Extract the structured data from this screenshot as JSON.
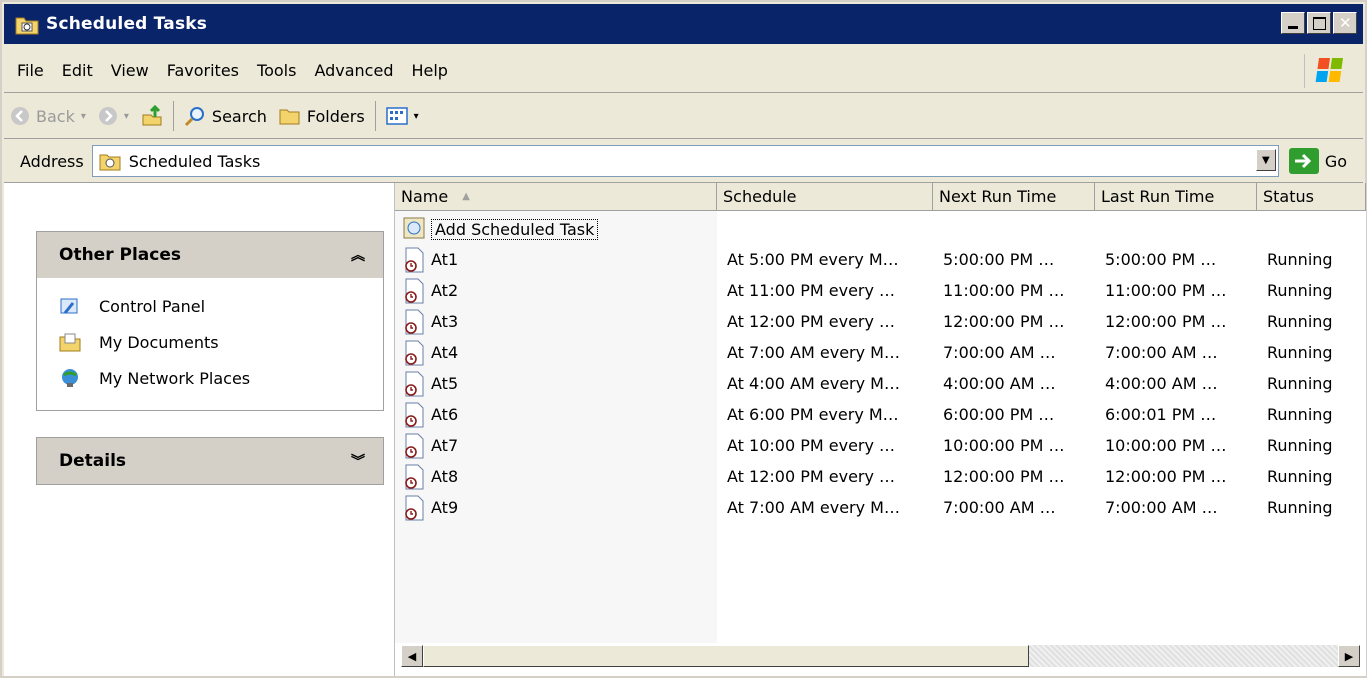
{
  "window": {
    "title": "Scheduled Tasks"
  },
  "menu": [
    "File",
    "Edit",
    "View",
    "Favorites",
    "Tools",
    "Advanced",
    "Help"
  ],
  "toolbar": {
    "back": "Back",
    "search": "Search",
    "folders": "Folders"
  },
  "address": {
    "label": "Address",
    "value": "Scheduled Tasks",
    "go": "Go"
  },
  "left_pane": {
    "other_places": {
      "title": "Other Places",
      "items": [
        {
          "label": "Control Panel",
          "icon": "control-panel-icon"
        },
        {
          "label": "My Documents",
          "icon": "my-documents-icon"
        },
        {
          "label": "My Network Places",
          "icon": "network-places-icon"
        }
      ]
    },
    "details": {
      "title": "Details"
    }
  },
  "list": {
    "columns": [
      "Name",
      "Schedule",
      "Next Run Time",
      "Last Run Time",
      "Status"
    ],
    "add_task": "Add Scheduled Task",
    "rows": [
      {
        "name": "At1",
        "schedule": "At 5:00 PM every M…",
        "next": "5:00:00 PM …",
        "last": "5:00:00 PM …",
        "status": "Running"
      },
      {
        "name": "At2",
        "schedule": "At 11:00 PM every …",
        "next": "11:00:00 PM …",
        "last": "11:00:00 PM …",
        "status": "Running"
      },
      {
        "name": "At3",
        "schedule": "At 12:00 PM every …",
        "next": "12:00:00 PM …",
        "last": "12:00:00 PM …",
        "status": "Running"
      },
      {
        "name": "At4",
        "schedule": "At 7:00 AM every M…",
        "next": "7:00:00 AM …",
        "last": "7:00:00 AM …",
        "status": "Running"
      },
      {
        "name": "At5",
        "schedule": "At 4:00 AM every M…",
        "next": "4:00:00 AM …",
        "last": "4:00:00 AM …",
        "status": "Running"
      },
      {
        "name": "At6",
        "schedule": "At 6:00 PM every M…",
        "next": "6:00:00 PM …",
        "last": "6:00:01 PM …",
        "status": "Running"
      },
      {
        "name": "At7",
        "schedule": "At 10:00 PM every …",
        "next": "10:00:00 PM …",
        "last": "10:00:00 PM …",
        "status": "Running"
      },
      {
        "name": "At8",
        "schedule": "At 12:00 PM every …",
        "next": "12:00:00 PM …",
        "last": "12:00:00 PM …",
        "status": "Running"
      },
      {
        "name": "At9",
        "schedule": "At 7:00 AM every M…",
        "next": "7:00:00 AM …",
        "last": "7:00:00 AM …",
        "status": "Running"
      }
    ]
  }
}
